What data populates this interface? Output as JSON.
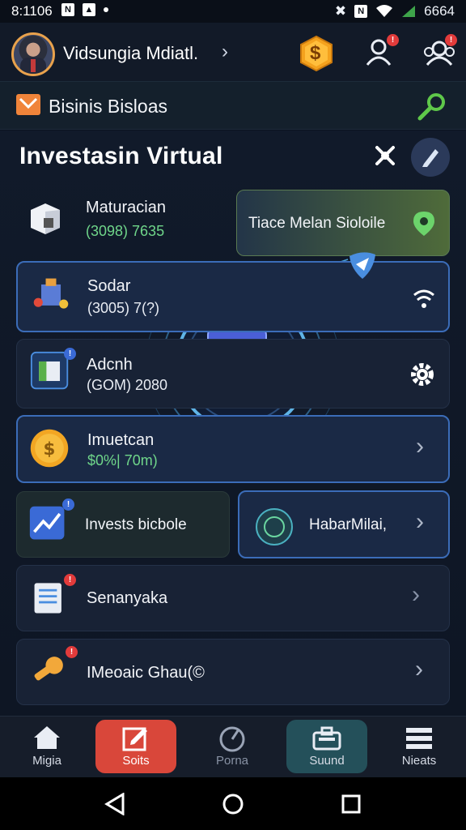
{
  "status": {
    "time": "8:1106",
    "battery": "6664"
  },
  "header": {
    "user_name": "Vidsungia Mdiatl.",
    "coin_symbol": "$"
  },
  "business_bar": {
    "title": "Bisinis Bisloas"
  },
  "section": {
    "title": "Investasin Virtual"
  },
  "cards": [
    {
      "title": "Maturacian",
      "sub": "(3098) 7635"
    },
    {
      "title": "Tiace Melan Sioloile"
    },
    {
      "title": "Sodar",
      "sub": "(3005) 7(?)"
    },
    {
      "title": "Adcnh",
      "sub": "(GOM) 2080"
    },
    {
      "title": "Imuetcan",
      "sub": "$0%| 70m)"
    },
    {
      "title": "Invests bicbole"
    },
    {
      "title": "HabarMilai,"
    },
    {
      "title": "Senanyaka"
    },
    {
      "title": "IMeoaic Ghau(©"
    }
  ],
  "badges": {
    "users": "!",
    "group": "!",
    "adcnh": "!",
    "invest_left": "!",
    "senanyaka": "!",
    "key": "!"
  },
  "nav": {
    "items": [
      {
        "label": "Migia"
      },
      {
        "label": "Soits"
      },
      {
        "label": "Porna"
      },
      {
        "label": "Suund"
      },
      {
        "label": "Nieats"
      }
    ]
  },
  "colors": {
    "accent_blue": "#3b6cb8",
    "green_value": "#6fd68a",
    "nav_active_red": "#d9473a",
    "nav_active_teal": "#24505a"
  }
}
